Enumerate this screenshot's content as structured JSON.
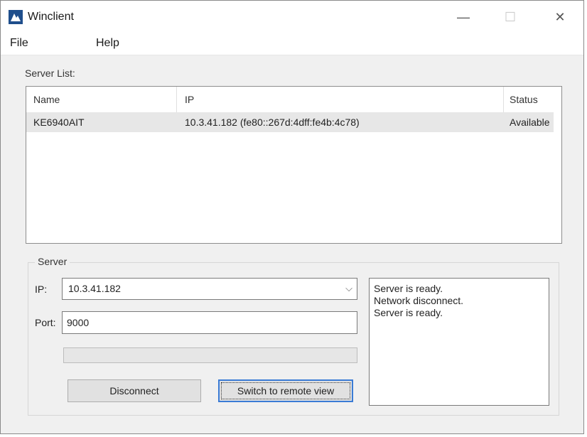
{
  "window": {
    "title": "Winclient",
    "minimize_glyph": "—",
    "maximize_glyph": "☐",
    "close_glyph": "✕"
  },
  "menu": {
    "file": "File",
    "help": "Help"
  },
  "server_list": {
    "label": "Server List:",
    "columns": [
      "Name",
      "IP",
      "Status"
    ],
    "rows": [
      {
        "name": "KE6940AIT",
        "ip": "10.3.41.182 (fe80::267d:4dff:fe4b:4c78)",
        "status": "Available"
      }
    ]
  },
  "server": {
    "group_label": "Server",
    "ip_label": "IP:",
    "ip_value": "10.3.41.182",
    "port_label": "Port:",
    "port_value": "9000",
    "progress": 0,
    "disconnect_label": "Disconnect",
    "switch_label": "Switch to remote view",
    "log": [
      "Server is ready.",
      "Network disconnect.",
      "Server is ready."
    ]
  },
  "colors": {
    "accent": "#3a7bd5",
    "app_icon": "#1f4e8c"
  },
  "icons": {
    "app": "winclient-app-icon",
    "dropdown": "chevron-down-icon",
    "dropdown_glyph": "⌵"
  }
}
